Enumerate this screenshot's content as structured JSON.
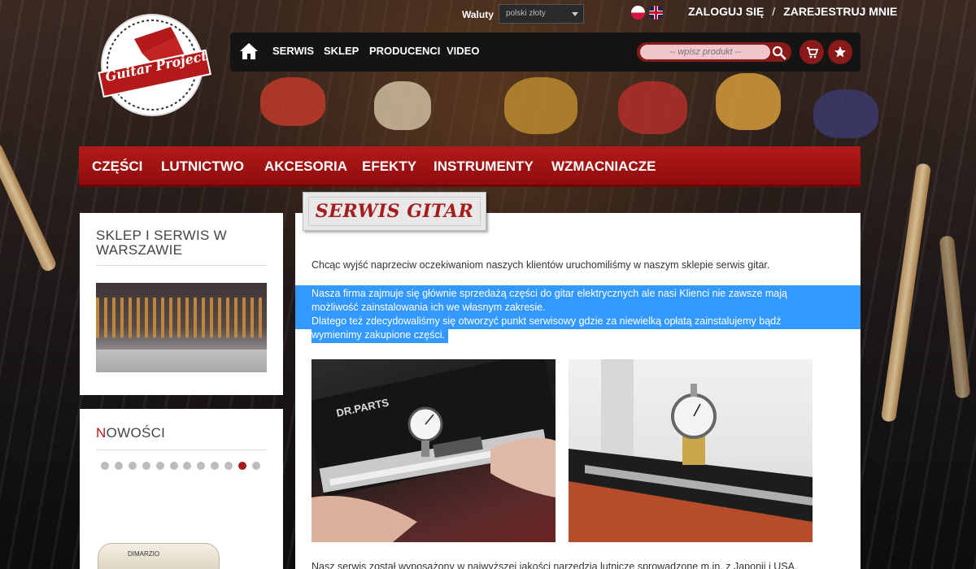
{
  "header": {
    "logo_text": "Guitar Project",
    "currency_label": "Waluty",
    "currency_selected": "polski złoty",
    "login": "ZALOGUJ SIĘ",
    "separator": "/",
    "register": "ZAREJESTRUJ MNIE"
  },
  "topnav": {
    "items": [
      {
        "label": "SERWIS"
      },
      {
        "label": "SKLEP"
      },
      {
        "label": "PRODUCENCI"
      },
      {
        "label": "VIDEO"
      }
    ],
    "search_placeholder": "-- wpisz produkt --"
  },
  "categories": [
    {
      "label": "CZĘŚCI"
    },
    {
      "label": "LUTNICTWO"
    },
    {
      "label": "AKCESORIA"
    },
    {
      "label": "EFEKTY"
    },
    {
      "label": "INSTRUMENTY"
    },
    {
      "label": "WZMACNIACZE"
    }
  ],
  "sidebar": {
    "store_title_line1": "SKLEP I SERWIS W",
    "store_title_line2": "WARSZAWIE",
    "news_first_letter": "N",
    "news_rest": "OWOŚCI",
    "pickup_brand": "DIMARZIO",
    "slider_count": 12,
    "slider_active": 10
  },
  "main": {
    "ribbon_title": "SERWIS GITAR",
    "p1": "Chcąc wyjść naprzeciw oczekiwaniom naszych klientów uruchomiliśmy w naszym sklepie serwis gitar.",
    "p2_l1": "Nasza firma zajmuje się głównie sprzedażą części do gitar elektrycznych ale nasi Klienci nie zawsze mają",
    "p2_l2": "możliwość zainstalowania ich we własnym zakresie.",
    "p2_l3": "Dlatego też zdecydowaliśmy się otworzyć punkt serwisowy gdzie za niewielką opłatą zainstalujemy bądź",
    "p2_l4": "wymienimy zakupione części.",
    "photo1_label": "DR.PARTS",
    "bottom": "Nasz serwis został wyposażony w najwyższej jakości narzędzia lutnicze sprowadzone m.in. z Japonii i USA."
  },
  "colors": {
    "brand_red": "#a51d1d",
    "menu_red": "#b21a1a",
    "highlight_blue": "#3399ff"
  }
}
